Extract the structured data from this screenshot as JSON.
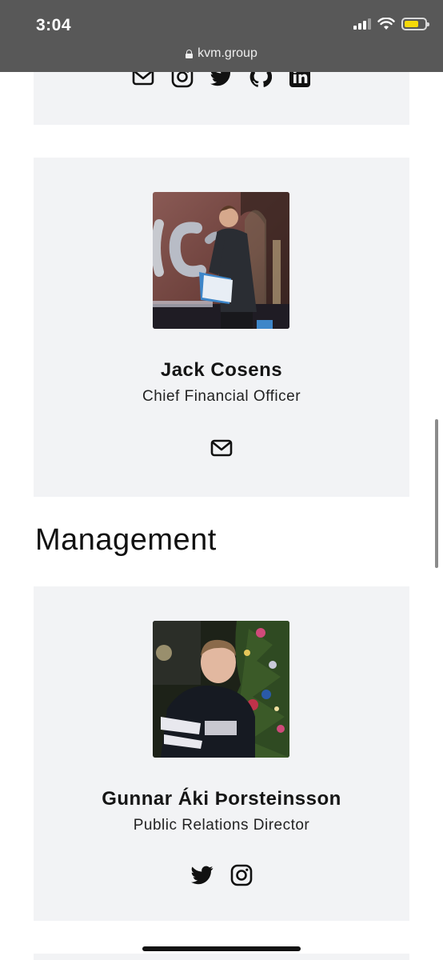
{
  "status_bar": {
    "time": "3:04",
    "url": "kvm.group",
    "battery_level": 0.7
  },
  "top_card": {
    "icons": [
      "mail-icon",
      "instagram-icon",
      "twitter-icon",
      "github-icon",
      "linkedin-icon"
    ]
  },
  "people": [
    {
      "name": "Jack Cosens",
      "role": "Chief Financial Officer",
      "icons": [
        "mail-icon"
      ]
    },
    {
      "name": "Gunnar Áki Þorsteinsson",
      "role": "Public Relations Director",
      "icons": [
        "twitter-icon",
        "instagram-icon"
      ]
    }
  ],
  "sections": {
    "management_title": "Management"
  },
  "colors": {
    "card_background": "#f2f3f5",
    "status_bar_background": "#585858",
    "text": "#111111"
  }
}
